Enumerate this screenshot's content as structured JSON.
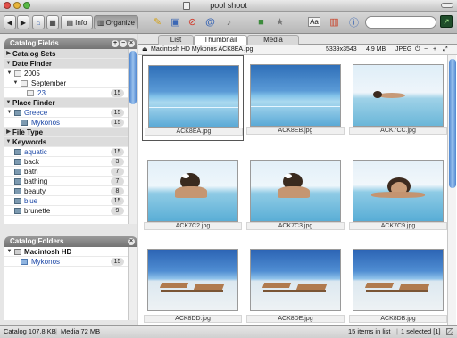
{
  "window": {
    "title": "pool shoot"
  },
  "toolbar": {
    "info_label": "Info",
    "organize_label": "Organize",
    "search_value": ""
  },
  "catalog_fields": {
    "header": "Catalog Fields",
    "rows": [
      {
        "label": "Catalog Sets",
        "type": "section",
        "count": ""
      },
      {
        "label": "Date Finder",
        "type": "section",
        "count": ""
      },
      {
        "label": "2005",
        "type": "item",
        "count": ""
      },
      {
        "label": "September",
        "type": "item",
        "count": ""
      },
      {
        "label": "23",
        "type": "item",
        "count": "15"
      },
      {
        "label": "Place Finder",
        "type": "section",
        "count": ""
      },
      {
        "label": "Greece",
        "type": "item",
        "count": "15"
      },
      {
        "label": "Mykonos",
        "type": "item",
        "count": "15"
      },
      {
        "label": "File Type",
        "type": "section",
        "count": ""
      },
      {
        "label": "Keywords",
        "type": "section",
        "count": ""
      },
      {
        "label": "aquatic",
        "type": "item",
        "count": "15"
      },
      {
        "label": "back",
        "type": "item",
        "count": "3"
      },
      {
        "label": "bath",
        "type": "item",
        "count": "7"
      },
      {
        "label": "bathing",
        "type": "item",
        "count": "7"
      },
      {
        "label": "beauty",
        "type": "item",
        "count": "8"
      },
      {
        "label": "blue",
        "type": "item",
        "count": "15"
      },
      {
        "label": "brunette",
        "type": "item",
        "count": "9"
      }
    ]
  },
  "catalog_folders": {
    "header": "Catalog Folders",
    "rows": [
      {
        "label": "Macintosh HD",
        "count": ""
      },
      {
        "label": "Mykonos",
        "count": "15"
      }
    ]
  },
  "tabs": [
    {
      "label": "List"
    },
    {
      "label": "Thumbnail"
    },
    {
      "label": "Media"
    }
  ],
  "pathbar": {
    "path": "Macintosh HD Mykonos ACK8EA.jpg",
    "dimensions": "5339x3543",
    "size": "4.9 MB",
    "format": "JPEG"
  },
  "thumbnails": [
    {
      "filename": "ACK8EA.jpg",
      "scene": "pool-horizon"
    },
    {
      "filename": "ACK8EB.jpg",
      "scene": "pool-horizon"
    },
    {
      "filename": "ACK7CC.jpg",
      "scene": "woman-lying"
    },
    {
      "filename": "ACK7C2.jpg",
      "scene": "woman-back"
    },
    {
      "filename": "ACK7C3.jpg",
      "scene": "woman-back"
    },
    {
      "filename": "ACK7C9.jpg",
      "scene": "woman-face"
    },
    {
      "filename": "ACK8DD.jpg",
      "scene": "chairs"
    },
    {
      "filename": "ACK8DE.jpg",
      "scene": "chairs"
    },
    {
      "filename": "ACK8DB.jpg",
      "scene": "chairs"
    }
  ],
  "statusbar": {
    "catalog": "Catalog  107.8 KB",
    "media": "Media 72 MB",
    "items": "15 items in list",
    "selected": "1 selected [1]"
  },
  "colors": {
    "accent_blue": "#1b47a6",
    "selection_blue": "#4f86d0"
  }
}
